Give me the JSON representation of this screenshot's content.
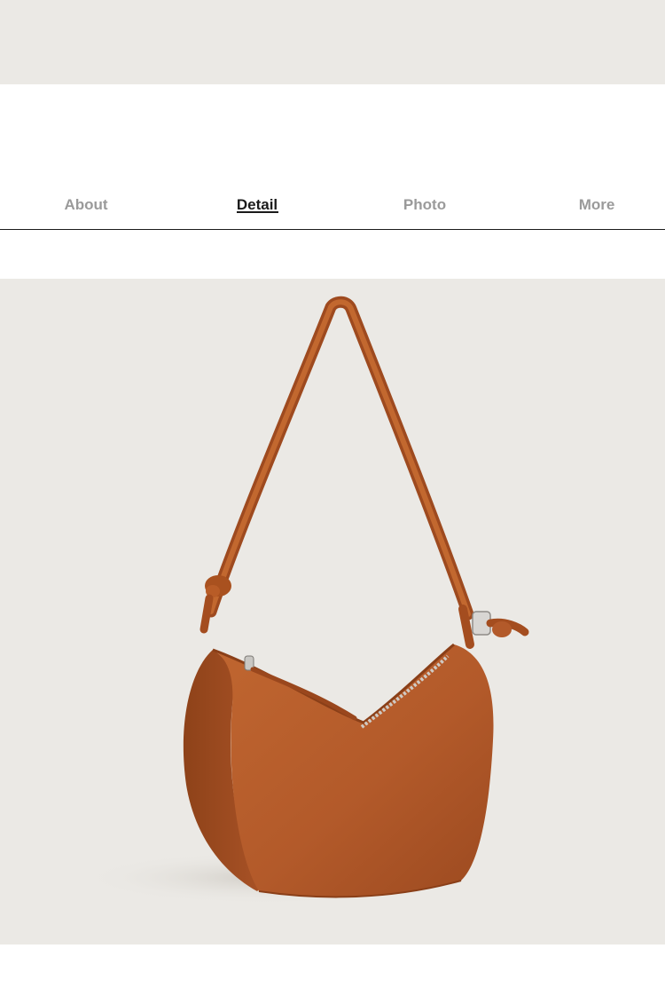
{
  "nav": {
    "tabs": [
      {
        "label": "About",
        "active": false
      },
      {
        "label": "Detail",
        "active": true
      },
      {
        "label": "Photo",
        "active": false
      },
      {
        "label": "More",
        "active": false
      }
    ]
  },
  "product": {
    "image_subject": "tan-leather-hobo-shoulder-bag",
    "bag_color": "#b35a2a",
    "background_color": "#ebe9e5"
  },
  "colors": {
    "active_tab": "#1b1b1b",
    "inactive_tab": "#9a9a9a",
    "top_band": "#ebe9e5"
  }
}
